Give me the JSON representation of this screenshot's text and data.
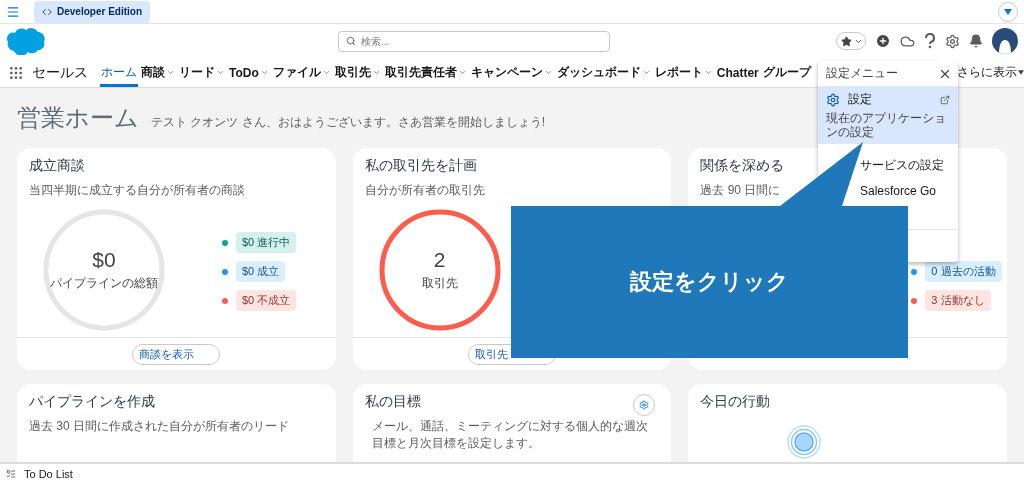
{
  "top_bar": {
    "app_tab": "Developer Edition"
  },
  "header": {
    "search": {
      "placeholder": "検索..."
    }
  },
  "nav": {
    "app_name": "セールス",
    "tabs": [
      {
        "label": "ホーム",
        "selected": true,
        "menu": false
      },
      {
        "label": "商談",
        "selected": false,
        "menu": true
      },
      {
        "label": "リード",
        "selected": false,
        "menu": true
      },
      {
        "label": "ToDo",
        "selected": false,
        "menu": true
      },
      {
        "label": "ファイル",
        "selected": false,
        "menu": true
      },
      {
        "label": "取引先",
        "selected": false,
        "menu": true
      },
      {
        "label": "取引先責任者",
        "selected": false,
        "menu": true
      },
      {
        "label": "キャンペーン",
        "selected": false,
        "menu": true
      },
      {
        "label": "ダッシュボード",
        "selected": false,
        "menu": true
      },
      {
        "label": "レポート",
        "selected": false,
        "menu": true
      },
      {
        "label": "Chatter",
        "selected": false,
        "menu": false
      },
      {
        "label": "グループ",
        "selected": false,
        "menu": false
      }
    ],
    "more": "さらに表示"
  },
  "page": {
    "title": "営業ホーム",
    "greeting": "テスト クオンツ さん、おはようございます。さあ営業を開始しましょう!"
  },
  "cards": [
    {
      "kind": "summary",
      "title": "成立商談",
      "subtitle": "当四半期に成立する自分が所有者の商談",
      "ring": {
        "value": "$0",
        "label": "パイプラインの総額",
        "color": "#e5e5e5"
      },
      "legend": [
        {
          "text": "$0 進行中",
          "color": "#06a59a"
        },
        {
          "text": "$0 成立",
          "color": "#1b96ff"
        },
        {
          "text": "$0 不成立",
          "color": "#fe5c4c"
        }
      ],
      "button": "商談を表示"
    },
    {
      "kind": "summary",
      "title": "私の取引先を計画",
      "subtitle": "自分が所有者の取引先",
      "ring": {
        "value": "2",
        "label": "取引先",
        "color": "#fe5c4c"
      },
      "button": "取引先"
    },
    {
      "kind": "summary",
      "title": "関係を深める",
      "subtitle": "過去 90 日間に",
      "legend": [
        {
          "text": "0 過去の活動",
          "color": "#1b96ff"
        },
        {
          "text": "3 活動なし",
          "color": "#fe5c4c"
        }
      ]
    },
    {
      "kind": "plain",
      "title": "パイプラインを作成",
      "subtitle": "過去 30 日間に作成された自分が所有者のリード"
    },
    {
      "kind": "goals",
      "title": "私の目標",
      "subtitle": "メール、通話、ミーティングに対する個人的な週次目標と月次目標を設定します。"
    },
    {
      "kind": "activity",
      "title": "今日の行動"
    }
  ],
  "settings_menu": {
    "title": "設定メニュー",
    "items": [
      {
        "label": "設定",
        "description": "現在のアプリケーションの設定",
        "selected": true
      },
      {
        "label": "サービスの設定",
        "selected": false
      },
      {
        "label": "Salesforce Go",
        "selected": false
      }
    ]
  },
  "callout": {
    "text": "設定をクリック"
  },
  "utility_bar": {
    "label": "To Do List"
  }
}
